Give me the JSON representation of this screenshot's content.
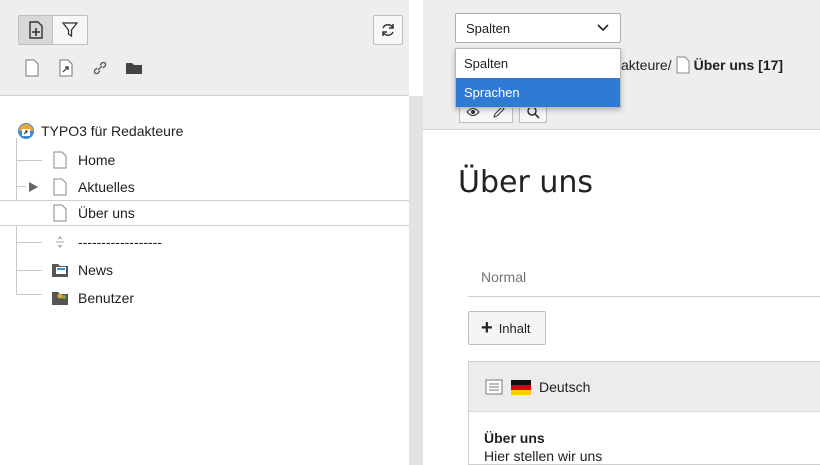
{
  "tree": {
    "root": "TYPO3 für Redakteure",
    "items": [
      {
        "label": "Home"
      },
      {
        "label": "Aktuelles"
      },
      {
        "label": "Über uns"
      },
      {
        "label": "------------------"
      },
      {
        "label": "News"
      },
      {
        "label": "Benutzer"
      }
    ]
  },
  "view_select": {
    "value": "Spalten",
    "options": [
      "Spalten",
      "Sprachen"
    ],
    "highlighted": "Sprachen"
  },
  "breadcrumb": {
    "path": "akteure/",
    "current": "Über uns [17]"
  },
  "main": {
    "title": "Über uns",
    "column_label": "Normal",
    "add_content_label": "Inhalt",
    "language_label": "Deutsch",
    "content_title": "Über uns",
    "content_text": "Hier stellen wir uns"
  },
  "colors": {
    "selection": "#2f7ad4",
    "toolbar_bg": "#eeeeee"
  }
}
